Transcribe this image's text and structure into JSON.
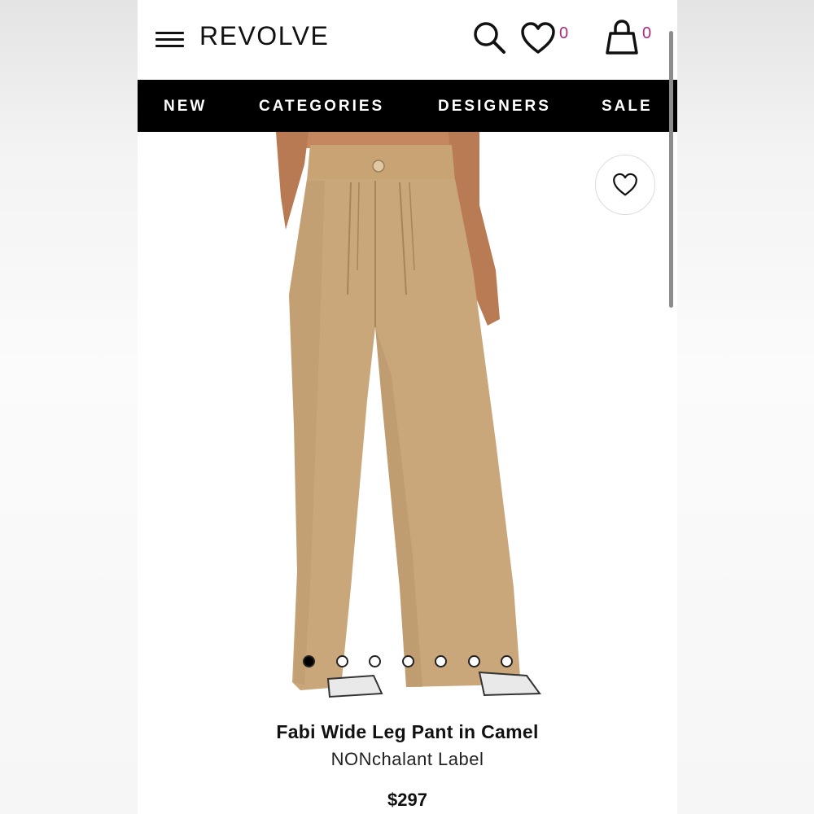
{
  "header": {
    "logo": "REVOLVE",
    "wishlist_count": "0",
    "bag_count": "0"
  },
  "nav": {
    "items": [
      "NEW",
      "CATEGORIES",
      "DESIGNERS",
      "SALE"
    ]
  },
  "product": {
    "title": "Fabi Wide Leg Pant in Camel",
    "brand": "NONchalant Label",
    "price": "$297",
    "image_count": 7,
    "active_image": 1
  },
  "colors": {
    "accent": "#b0287e",
    "nav_bg": "#000000",
    "fabric": "#c9a77a"
  },
  "icons": [
    "menu-icon",
    "search-icon",
    "heart-icon",
    "bag-icon"
  ]
}
